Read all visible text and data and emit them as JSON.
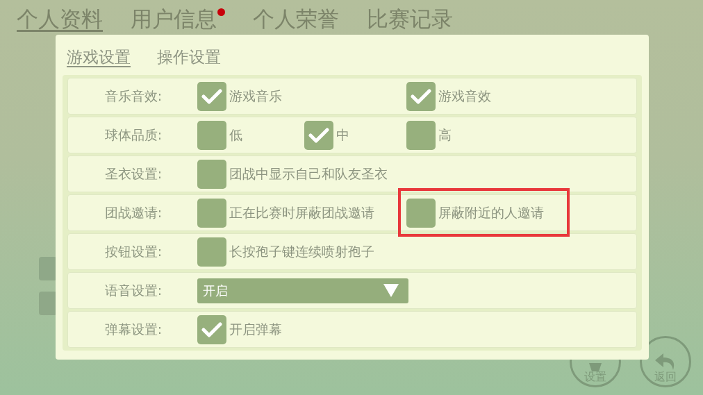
{
  "top_tabs": [
    {
      "label": "个人资料",
      "selected": true,
      "badge": false
    },
    {
      "label": "用户信息",
      "selected": false,
      "badge": true
    },
    {
      "label": "个人荣誉",
      "selected": false,
      "badge": false
    },
    {
      "label": "比赛记录",
      "selected": false,
      "badge": false
    }
  ],
  "sub_tabs": [
    {
      "label": "游戏设置",
      "selected": true
    },
    {
      "label": "操作设置",
      "selected": false
    }
  ],
  "settings": [
    {
      "label": "音乐音效:",
      "kind": "checks",
      "options": [
        {
          "text": "游戏音乐",
          "checked": true,
          "highlighted": false
        },
        {
          "text": "游戏音效",
          "checked": true,
          "highlighted": false
        }
      ]
    },
    {
      "label": "球体品质:",
      "kind": "checks",
      "options": [
        {
          "text": "低",
          "checked": false,
          "highlighted": false
        },
        {
          "text": "中",
          "checked": true,
          "highlighted": false
        },
        {
          "text": "高",
          "checked": false,
          "highlighted": false
        }
      ]
    },
    {
      "label": "圣衣设置:",
      "kind": "checks",
      "options": [
        {
          "text": "团战中显示自己和队友圣衣",
          "checked": false,
          "highlighted": false
        }
      ]
    },
    {
      "label": "团战邀请:",
      "kind": "checks",
      "options": [
        {
          "text": "正在比赛时屏蔽团战邀请",
          "checked": false,
          "highlighted": false
        },
        {
          "text": "屏蔽附近的人邀请",
          "checked": false,
          "highlighted": true
        }
      ]
    },
    {
      "label": "按钮设置:",
      "kind": "checks",
      "options": [
        {
          "text": "长按孢子键连续喷射孢子",
          "checked": false,
          "highlighted": false
        }
      ]
    },
    {
      "label": "语音设置:",
      "kind": "dropdown",
      "value": "开启"
    },
    {
      "label": "弹幕设置:",
      "kind": "checks",
      "options": [
        {
          "text": "开启弹幕",
          "checked": true,
          "highlighted": false
        }
      ]
    }
  ],
  "corner_buttons": [
    {
      "label": "设置"
    },
    {
      "label": "返回"
    }
  ]
}
